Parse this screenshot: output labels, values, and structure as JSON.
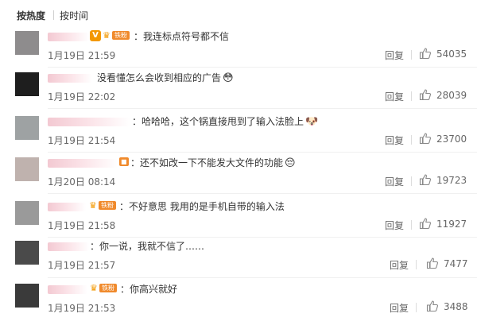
{
  "tabs": [
    {
      "label": "按热度"
    },
    {
      "label": "按时间"
    }
  ],
  "reply_label": "回复",
  "colors": {
    "orange_badge": "#f39800",
    "fan_badge": "#f08a2c"
  },
  "comments": [
    {
      "text": "：我连标点符号都不信",
      "time": "1月19日 21:59",
      "likes": "54035",
      "badges": [
        "verified-v",
        "crown",
        "fan"
      ]
    },
    {
      "text": "没看懂怎么会收到相应的广告",
      "emoji": "shy-face-emoji",
      "time": "1月19日 22:02",
      "likes": "28039",
      "badges": []
    },
    {
      "text": "：哈哈哈，这个锅直接甩到了输入法脸上",
      "emoji": "dog-face-emoji",
      "time": "1月19日 21:54",
      "likes": "23700",
      "badges": []
    },
    {
      "text": "：还不如改一下不能发大文件的功能",
      "emoji": "sad-face-emoji",
      "time": "1月20日 08:14",
      "likes": "19723",
      "badges": [
        "fan"
      ]
    },
    {
      "text": "：不好意思 我用的是手机自带的输入法",
      "time": "1月19日 21:58",
      "likes": "11927",
      "badges": [
        "crown",
        "fan"
      ]
    },
    {
      "text": "：你一说，我就不信了……",
      "time": "1月19日 21:57",
      "likes": "7477",
      "badges": []
    },
    {
      "text": "：你高兴就好",
      "time": "1月19日 21:53",
      "likes": "3488",
      "badges": [
        "crown",
        "fan"
      ]
    }
  ],
  "fan_badge_label": "铁粉",
  "v_badge_label": "V"
}
